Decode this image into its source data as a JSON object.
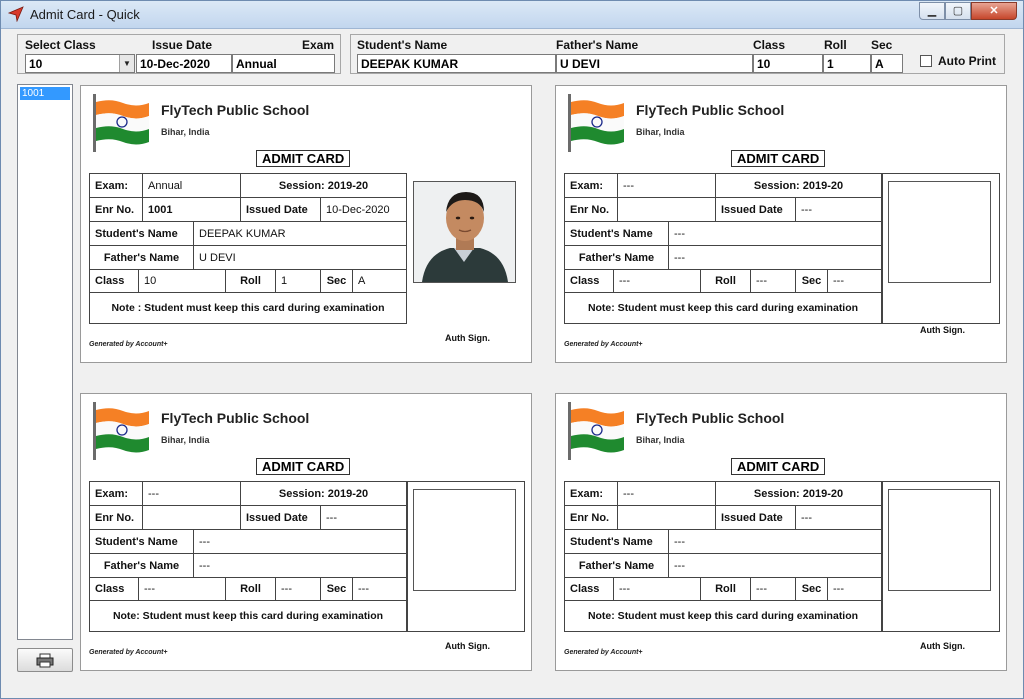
{
  "window": {
    "title": "Admit Card - Quick"
  },
  "filters": {
    "select_class_label": "Select Class",
    "issue_date_label": "Issue Date",
    "exam_label": "Exam",
    "class_value": "10",
    "issue_date_value": "10-Dec-2020",
    "exam_value": "Annual"
  },
  "student": {
    "name_label": "Student's Name",
    "father_label": "Father's Name",
    "class_label": "Class",
    "roll_label": "Roll",
    "sec_label": "Sec",
    "name_value": "DEEPAK KUMAR",
    "father_value": "U DEVI",
    "class_value": "10",
    "roll_value": "1",
    "sec_value": "A",
    "auto_print_label": "Auto Print"
  },
  "list": {
    "items": [
      "1001"
    ]
  },
  "card_common": {
    "school_name": "FlyTech Public School",
    "location": "Bihar, India",
    "admit_title": "ADMIT CARD",
    "exam_lbl": "Exam:",
    "session": "Session: 2019-20",
    "enr_lbl": "Enr No.",
    "issued_lbl": "Issued Date",
    "student_lbl": "Student's Name",
    "father_lbl": "Father's Name",
    "class_lbl": "Class",
    "roll_lbl": "Roll",
    "sec_lbl": "Sec",
    "note": "Note: Student must keep this card during examination",
    "note_first": "Note : Student must keep this card during examination",
    "auth": "Auth Sign.",
    "generated": "Generated by Account+"
  },
  "cards": [
    {
      "exam": "Annual",
      "enr": "1001",
      "issued": "10-Dec-2020",
      "student": "DEEPAK KUMAR",
      "father": "U DEVI",
      "class": "10",
      "roll": "1",
      "sec": "A"
    },
    {
      "exam": "---",
      "enr": "",
      "issued": "---",
      "student": "---",
      "father": "---",
      "class": "---",
      "roll": "---",
      "sec": "---"
    },
    {
      "exam": "---",
      "enr": "",
      "issued": "---",
      "student": "---",
      "father": "---",
      "class": "---",
      "roll": "---",
      "sec": "---"
    },
    {
      "exam": "---",
      "enr": "",
      "issued": "---",
      "student": "---",
      "father": "---",
      "class": "---",
      "roll": "---",
      "sec": "---"
    }
  ]
}
